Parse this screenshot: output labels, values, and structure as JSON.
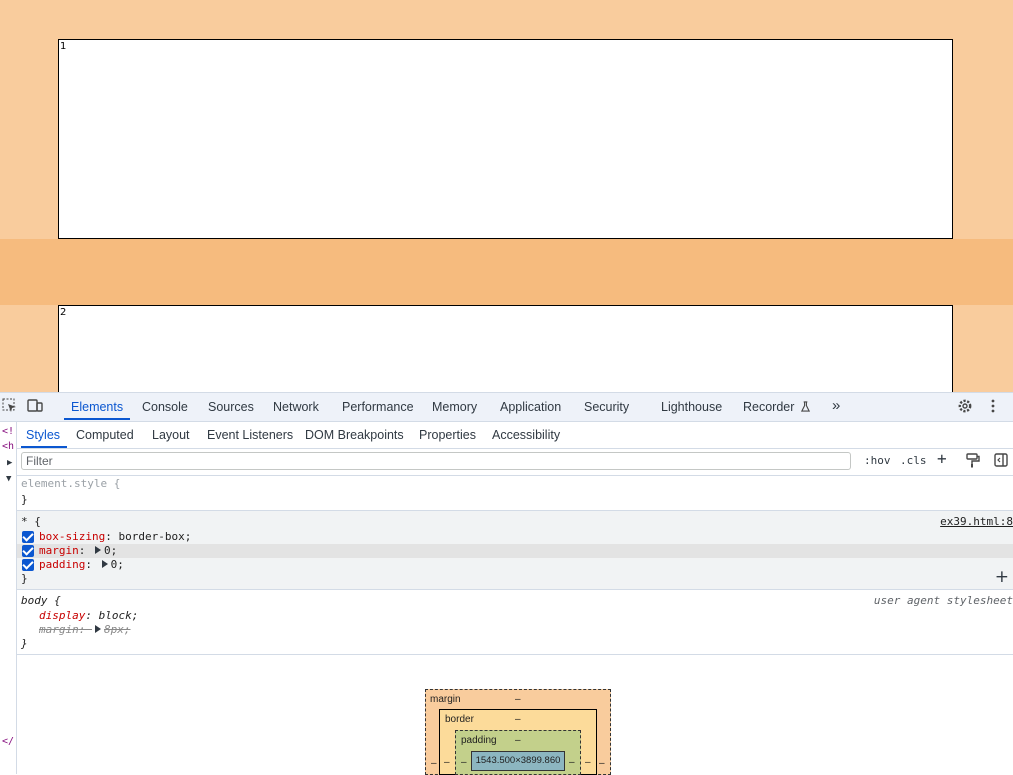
{
  "page": {
    "boxes": [
      {
        "number": "1"
      },
      {
        "number": "2"
      }
    ]
  },
  "devtools": {
    "tabs": [
      "Elements",
      "Console",
      "Sources",
      "Network",
      "Performance",
      "Memory",
      "Application",
      "Security",
      "Lighthouse",
      "Recorder"
    ],
    "active_tab": "Elements",
    "more_tabs": "»",
    "subtabs": [
      "Styles",
      "Computed",
      "Layout",
      "Event Listeners",
      "DOM Breakpoints",
      "Properties",
      "Accessibility"
    ],
    "active_subtab": "Styles",
    "filter": {
      "placeholder": "Filter",
      "value": ""
    },
    "filter_buttons": {
      "hov": ":hov",
      "cls": ".cls",
      "add": "+"
    },
    "left_strip": [
      "<!",
      "<h",
      "▶",
      "▼",
      "</"
    ],
    "rules": {
      "element_style": {
        "selector": "element.style {",
        "close": "}"
      },
      "universal": {
        "selector": "* {",
        "source": "ex39.html:8",
        "props": [
          {
            "name": "box-sizing",
            "value": "border-box;"
          },
          {
            "name": "margin",
            "value": "0;"
          },
          {
            "name": "padding",
            "value": "0;"
          }
        ],
        "close": "}"
      },
      "body": {
        "selector": "body {",
        "source": "user agent stylesheet",
        "props": [
          {
            "name": "display",
            "value": "block;"
          },
          {
            "name": "margin",
            "value": "8px;"
          }
        ],
        "close": "}"
      }
    },
    "box_model": {
      "margin_label": "margin",
      "border_label": "border",
      "padding_label": "padding",
      "dash": "–",
      "content_size": "1543.500×3899.860"
    }
  },
  "colors": {
    "page_bg": "#f9cc9d",
    "band": "#f6bb7e",
    "accent": "#0b57d0",
    "prop": "#c80000"
  }
}
